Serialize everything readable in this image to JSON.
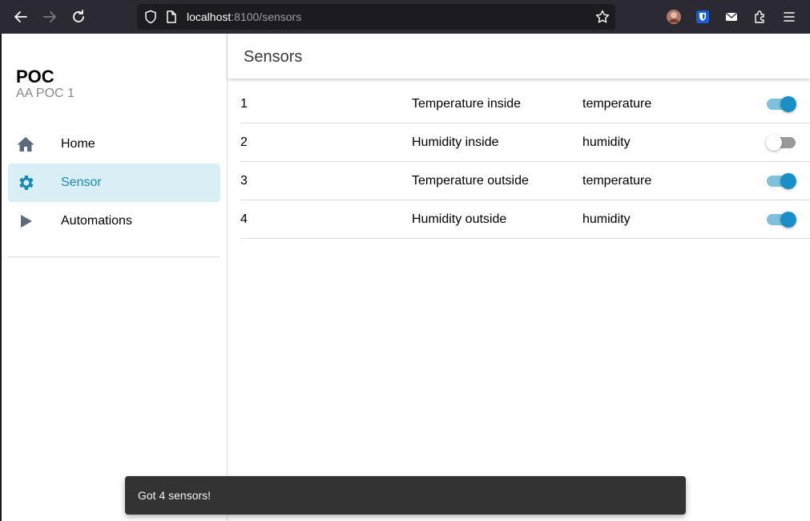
{
  "browser": {
    "url_host": "localhost",
    "url_path": ":8100/sensors"
  },
  "sidebar": {
    "title": "POC",
    "subtitle": "AA POC 1",
    "items": [
      {
        "label": "Home",
        "icon": "home-icon",
        "active": false
      },
      {
        "label": "Sensor",
        "icon": "gear-icon",
        "active": true
      },
      {
        "label": "Automations",
        "icon": "play-icon",
        "active": false
      }
    ]
  },
  "header": {
    "title": "Sensors"
  },
  "sensors": [
    {
      "id": "1",
      "name": "Temperature inside",
      "type": "temperature",
      "enabled": true
    },
    {
      "id": "2",
      "name": "Humidity inside",
      "type": "humidity",
      "enabled": false
    },
    {
      "id": "3",
      "name": "Temperature outside",
      "type": "temperature",
      "enabled": true
    },
    {
      "id": "4",
      "name": "Humidity outside",
      "type": "humidity",
      "enabled": true
    }
  ],
  "toast": {
    "message": "Got 4 sensors!"
  },
  "colors": {
    "accent": "#1a8fc7",
    "active_bg": "#daeef5"
  }
}
